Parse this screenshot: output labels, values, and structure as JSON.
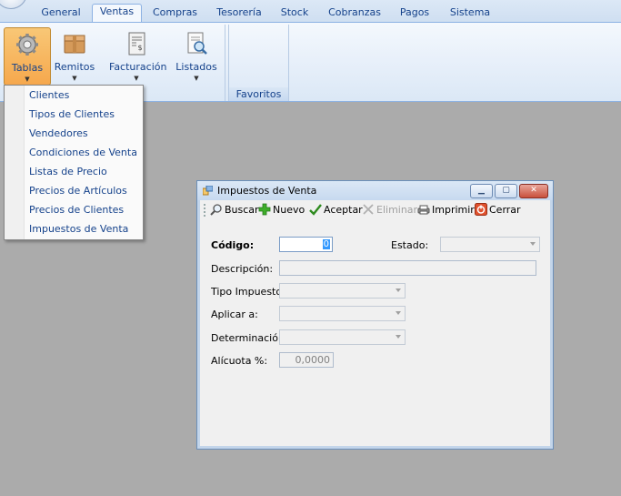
{
  "ribbon": {
    "tabs": [
      {
        "label": "General"
      },
      {
        "label": "Ventas"
      },
      {
        "label": "Compras"
      },
      {
        "label": "Tesorería"
      },
      {
        "label": "Stock"
      },
      {
        "label": "Cobranzas"
      },
      {
        "label": "Pagos"
      },
      {
        "label": "Sistema"
      }
    ],
    "active_tab": "Ventas",
    "buttons": {
      "tablas": "Tablas",
      "remitos": "Remitos",
      "facturacion": "Facturación",
      "listados": "Listados"
    },
    "groups": {
      "favoritos": "Favoritos"
    }
  },
  "menu": {
    "items": [
      {
        "label": "Clientes"
      },
      {
        "label": "Tipos de Clientes"
      },
      {
        "label": "Vendedores"
      },
      {
        "label": "Condiciones de Venta"
      },
      {
        "label": "Listas de Precio"
      },
      {
        "label": "Precios de Artículos"
      },
      {
        "label": "Precios de Clientes"
      },
      {
        "label": "Impuestos de Venta"
      }
    ]
  },
  "dialog": {
    "title": "Impuestos de Venta",
    "toolbar": {
      "buscar": "Buscar",
      "nuevo": "Nuevo",
      "aceptar": "Aceptar",
      "eliminar": "Eliminar",
      "imprimir": "Imprimir",
      "cerrar": "Cerrar"
    },
    "fields": {
      "codigo_label": "Código:",
      "codigo_value": "0",
      "estado_label": "Estado:",
      "descripcion_label": "Descripción:",
      "tipo_impuesto_label": "Tipo Impuesto:",
      "aplicar_label": "Aplicar a:",
      "determinacion_label": "Determinación:",
      "alicuota_label": "Alícuota %:",
      "alicuota_value": "0,0000"
    }
  },
  "colors": {
    "ribbon_text": "#15428b",
    "pressed_button": "#f6a84d",
    "desktop": "#ababab",
    "selection": "#3399ff"
  }
}
